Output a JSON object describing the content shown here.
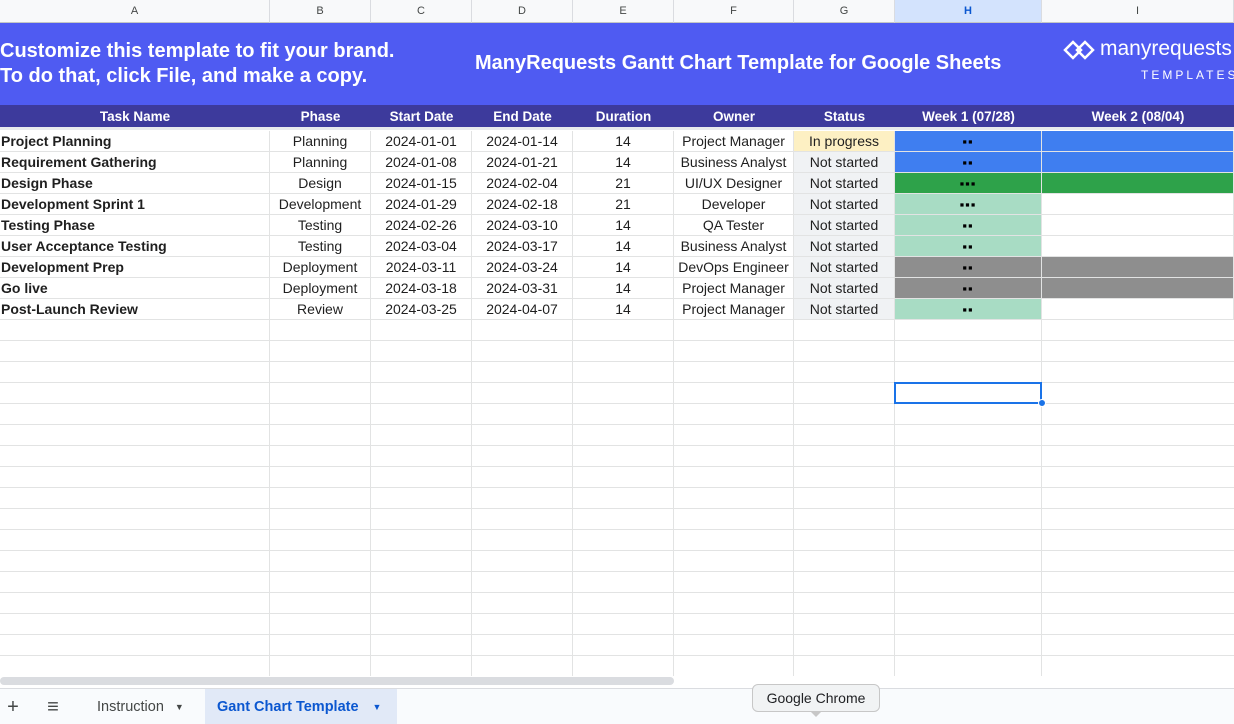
{
  "columns": [
    "A",
    "B",
    "C",
    "D",
    "E",
    "F",
    "G",
    "H",
    "I"
  ],
  "selected_column": "H",
  "banner": {
    "left_line1": "Customize this template to fit your brand.",
    "left_line2": "To do that, click File, and make a copy.",
    "title": "ManyRequests Gantt Chart Template for Google Sheets",
    "brand": "manyrequests",
    "brand_sub": "TEMPLATES"
  },
  "headers": [
    "Task Name",
    "Phase",
    "Start Date",
    "End Date",
    "Duration",
    "Owner",
    "Status",
    "Week 1 (07/28)",
    "Week 2 (08/04)"
  ],
  "rows": [
    {
      "task": "Project Planning",
      "phase": "Planning",
      "start": "2024-01-01",
      "end": "2024-01-14",
      "duration": "14",
      "owner": "Project Manager",
      "status": "In progress",
      "dots": "▪▪"
    },
    {
      "task": "Requirement Gathering",
      "phase": "Planning",
      "start": "2024-01-08",
      "end": "2024-01-21",
      "duration": "14",
      "owner": "Business Analyst",
      "status": "Not started",
      "dots": "▪▪"
    },
    {
      "task": "Design Phase",
      "phase": "Design",
      "start": "2024-01-15",
      "end": "2024-02-04",
      "duration": "21",
      "owner": "UI/UX Designer",
      "status": "Not started",
      "dots": "▪▪▪"
    },
    {
      "task": "Development Sprint 1",
      "phase": "Development",
      "start": "2024-01-29",
      "end": "2024-02-18",
      "duration": "21",
      "owner": "Developer",
      "status": "Not started",
      "dots": "▪▪▪"
    },
    {
      "task": "Testing Phase",
      "phase": "Testing",
      "start": "2024-02-26",
      "end": "2024-03-10",
      "duration": "14",
      "owner": "QA Tester",
      "status": "Not started",
      "dots": "▪▪"
    },
    {
      "task": "User Acceptance Testing",
      "phase": "Testing",
      "start": "2024-03-04",
      "end": "2024-03-17",
      "duration": "14",
      "owner": "Business Analyst",
      "status": "Not started",
      "dots": "▪▪"
    },
    {
      "task": "Development Prep",
      "phase": "Deployment",
      "start": "2024-03-11",
      "end": "2024-03-24",
      "duration": "14",
      "owner": "DevOps Engineer",
      "status": "Not started",
      "dots": "▪▪"
    },
    {
      "task": "Go live",
      "phase": "Deployment",
      "start": "2024-03-18",
      "end": "2024-03-31",
      "duration": "14",
      "owner": "Project Manager",
      "status": "Not started",
      "dots": "▪▪"
    },
    {
      "task": "Post-Launch Review",
      "phase": "Review",
      "start": "2024-03-25",
      "end": "2024-04-07",
      "duration": "14",
      "owner": "Project Manager",
      "status": "Not started",
      "dots": "▪▪"
    }
  ],
  "phase_colors": {
    "Planning": "#3f7ef0",
    "Design": "#2ea24a",
    "Development": "#a8dcc4",
    "Testing": "#a8dcc4",
    "Deployment": "#8e8e8e",
    "Review": "#a8dcc4"
  },
  "status_colors": {
    "In progress": "#fdf0c3",
    "Not started": "#f0f2f4"
  },
  "sheets": {
    "add_icon": "+",
    "menu_icon": "≡",
    "tabs": [
      {
        "label": "Instruction",
        "active": false
      },
      {
        "label": "Gant Chart Template",
        "active": true
      }
    ]
  },
  "tooltip": "Google Chrome"
}
